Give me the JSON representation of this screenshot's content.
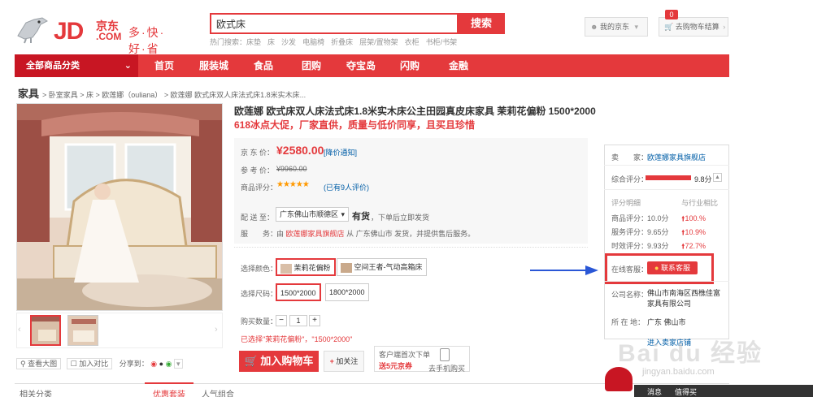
{
  "header": {
    "logo_jd": "JD",
    "logo_cn": "京东",
    "logo_com": ".COM",
    "slogan": "多·快·好·省",
    "search_value": "欧式床",
    "search_button": "搜索",
    "hot_label": "热门搜索：",
    "hot_terms": [
      "床垫",
      "床",
      "沙发",
      "电脑椅",
      "折叠床",
      "层架/置物架",
      "衣柜",
      "书柜/书架"
    ],
    "my_jd": "我的京东",
    "cart_label": "去购物车结算",
    "cart_count": "0"
  },
  "nav": {
    "category": "全部商品分类",
    "items": [
      "首页",
      "服装城",
      "食品",
      "团购",
      "夺宝岛",
      "闪购",
      "金融"
    ]
  },
  "breadcrumb": {
    "root": "家具",
    "path": "> 卧室家具 > 床 > 欧莲娜（ouliana） > 欧莲娜 欧式床双人床法式床1.8米实木床..."
  },
  "product": {
    "title": "欧莲娜 欧式床双人床法式床1.8米实木床公主田园真皮床家具 茉莉花偏粉 1500*2000",
    "subtitle": "618冰点大促，厂家直供，质量与低价同享，且买且珍惜",
    "price_label": "京 东 价：",
    "price": "¥2580.00",
    "price_notice": "[降价通知]",
    "ref_label": "参 考 价：",
    "ref_price": "¥9960.00",
    "rating_label": "商品评分：",
    "rating_stars": "★★★★★",
    "rating_count": "(已有9人评价)",
    "ship_label": "配 送 至：",
    "ship_region": "广东佛山市顺德区",
    "stock": "有货",
    "stock_note": "，下单后立即发货",
    "service_label": "服　　务：",
    "service_prefix": "由",
    "service_store": "欧莲娜家具旗舰店",
    "service_suffix": "从 广东佛山市 发货，并提供售后服务。",
    "color_label": "选择颜色：",
    "colors": [
      "茉莉花偏粉",
      "空间王者-气动高箱床"
    ],
    "size_label": "选择尺码：",
    "sizes": [
      "1500*2000",
      "1800*2000"
    ],
    "qty_label": "购买数量：",
    "qty": "1",
    "selected_text": "已选择\"茉莉花偏粉\"，\"1500*2000\"",
    "add_cart": "加入购物车",
    "follow": "加关注",
    "mobile_line1": "客户端首次下单",
    "mobile_line2": "送5元京券",
    "mobile_line3": "去手机购买",
    "view_large": "查看大图",
    "compare": "加入对比",
    "share": "分享到："
  },
  "store": {
    "seller_label": "卖　　家：",
    "seller": "欧莲娜家具旗舰店",
    "overall_label": "综合评分：",
    "overall": "9.8分",
    "detail_label": "评分明细",
    "compare_label": "与行业相比",
    "rows": [
      {
        "label": "商品评分：",
        "value": "10.0分",
        "delta": "100.%"
      },
      {
        "label": "服务评分：",
        "value": "9.65分",
        "delta": "10.9%"
      },
      {
        "label": "时效评分：",
        "value": "9.93分",
        "delta": "72.7%"
      }
    ],
    "kefu_label": "在线客服：",
    "kefu_button": "联系客服",
    "company_label": "公司名称：",
    "company": "佛山市南海区西樵佳富家具有限公司",
    "location_label": "所 在 地：",
    "location": "广东 佛山市",
    "enter_store": "进入卖家店铺"
  },
  "tabs": {
    "related": "相关分类",
    "items": [
      "优惠套装",
      "人气组合"
    ]
  },
  "corner": {
    "items": [
      "消息",
      "值得买"
    ]
  },
  "watermark": "Bai du 经验",
  "watermark_sub": "jingyan.baidu.com",
  "colors": {
    "brand_red": "#e4393c",
    "nav_dark": "#c81623",
    "link_blue": "#005ea7"
  }
}
